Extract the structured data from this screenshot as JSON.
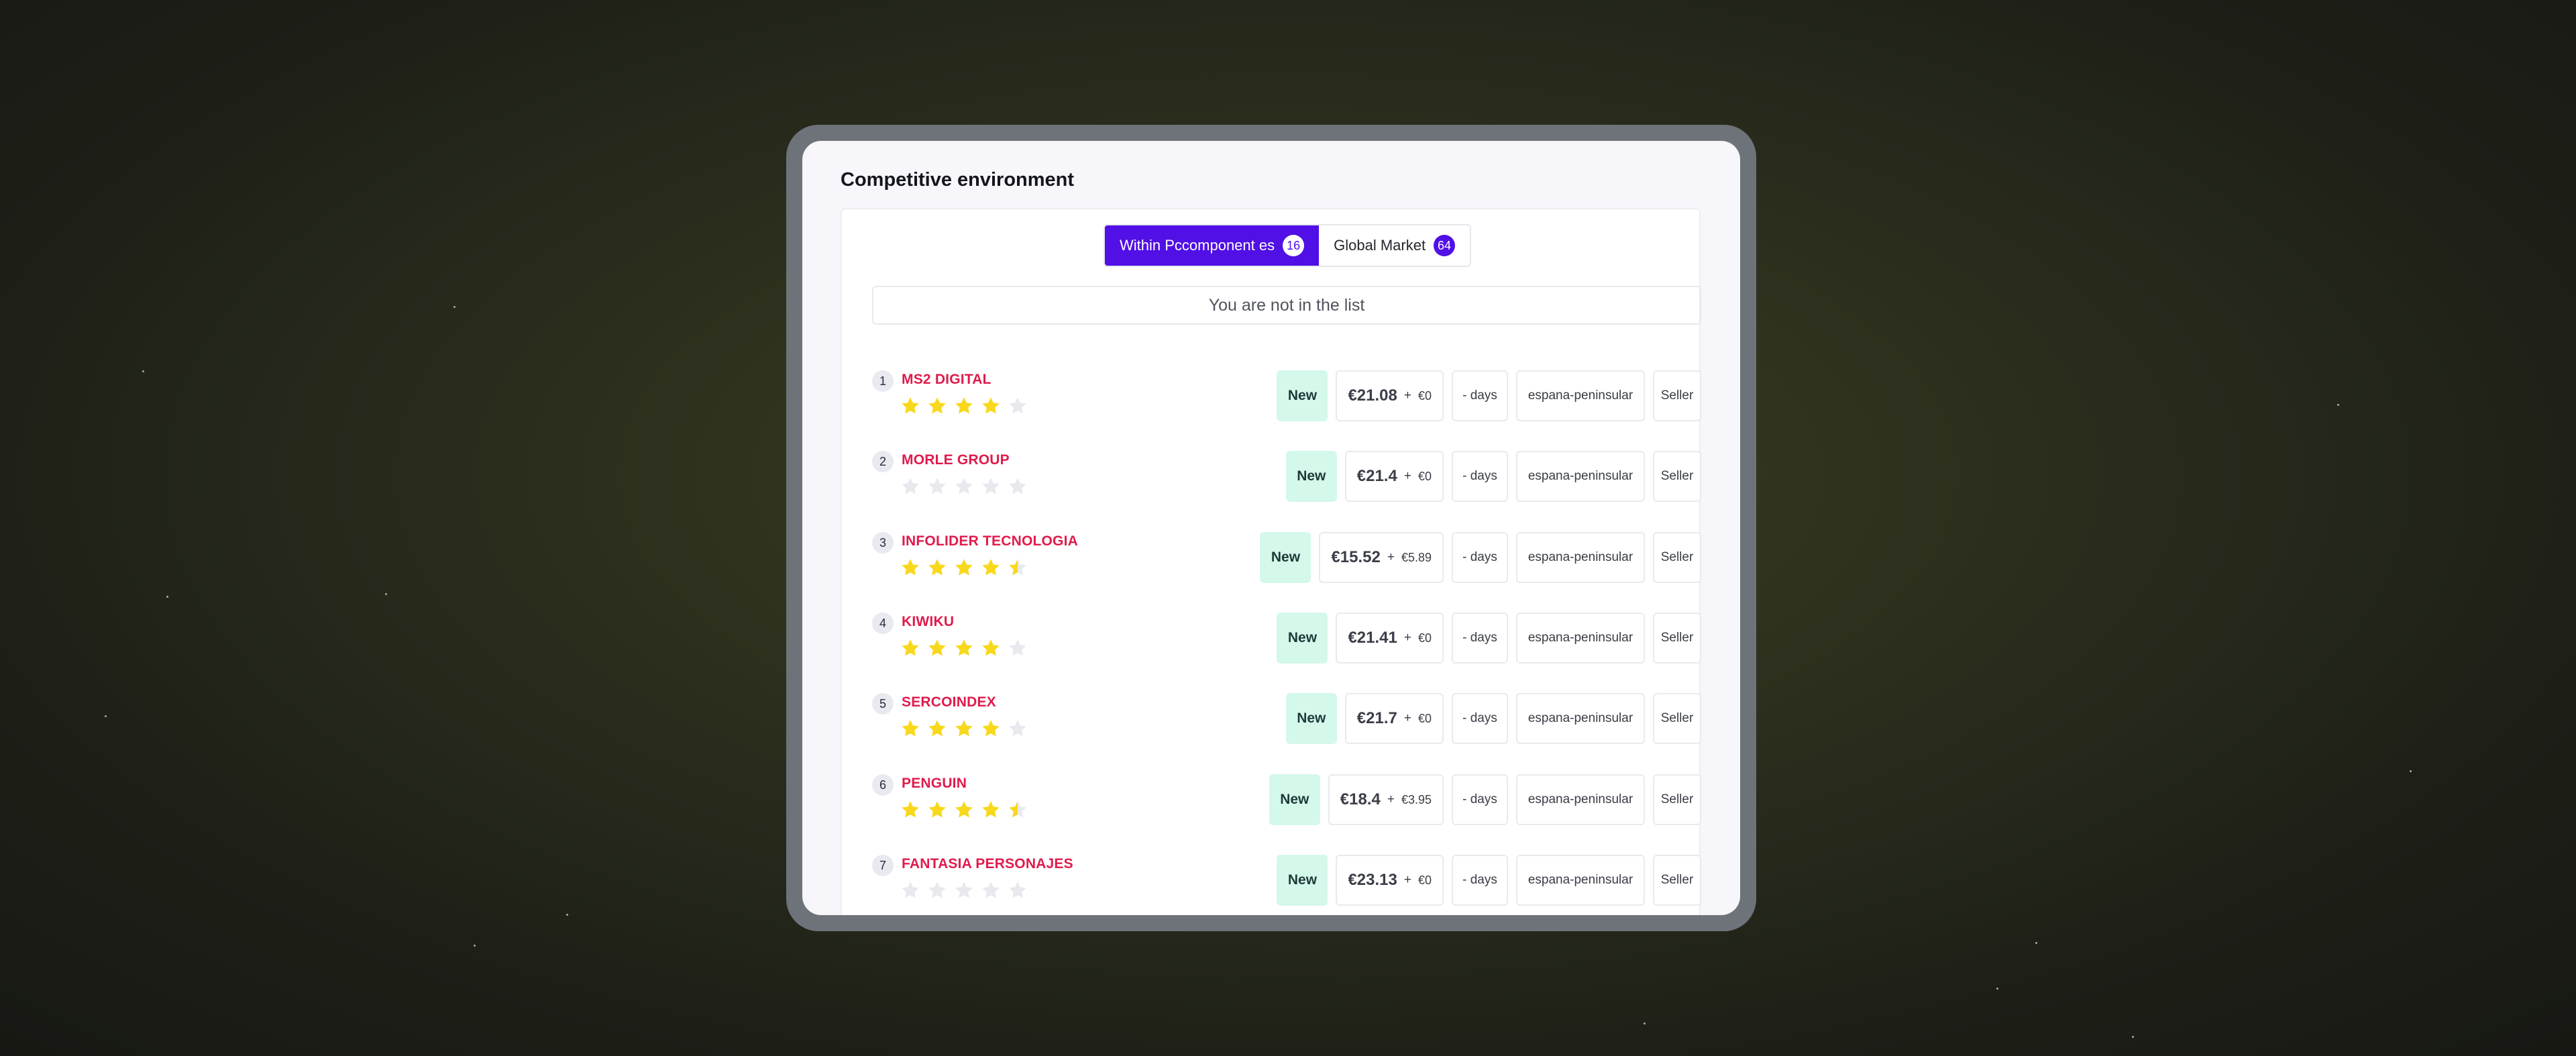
{
  "panel": {
    "title": "Competitive environment"
  },
  "tabs": [
    {
      "label": "Within Pccomponent es",
      "count": "16",
      "active": true
    },
    {
      "label": "Global Market",
      "count": "64",
      "active": false
    }
  ],
  "notice": "You are not in the list",
  "colors": {
    "accent": "#5010e6",
    "seller_name": "#e01b4c",
    "new_badge_bg": "#d4f8ea",
    "star_filled": "#f8d81c",
    "star_empty": "#e8e9ee"
  },
  "sellers": [
    {
      "rank": "1",
      "name": "MS2 DIGITAL",
      "rating": 4,
      "condition": "New",
      "price": "€21.08",
      "plus": "+",
      "shipping": "€0",
      "delivery": "- days",
      "region": "espana-peninsular",
      "role": "Seller"
    },
    {
      "rank": "2",
      "name": "MORLE GROUP",
      "rating": 0,
      "condition": "New",
      "price": "€21.4",
      "plus": "+",
      "shipping": "€0",
      "delivery": "- days",
      "region": "espana-peninsular",
      "role": "Seller"
    },
    {
      "rank": "3",
      "name": "INFOLIDER TECNOLOGIA",
      "rating": 4.5,
      "condition": "New",
      "price": "€15.52",
      "plus": "+",
      "shipping": "€5.89",
      "delivery": "- days",
      "region": "espana-peninsular",
      "role": "Seller"
    },
    {
      "rank": "4",
      "name": "KIWIKU",
      "rating": 4,
      "condition": "New",
      "price": "€21.41",
      "plus": "+",
      "shipping": "€0",
      "delivery": "- days",
      "region": "espana-peninsular",
      "role": "Seller"
    },
    {
      "rank": "5",
      "name": "SERCOINDEX",
      "rating": 4,
      "condition": "New",
      "price": "€21.7",
      "plus": "+",
      "shipping": "€0",
      "delivery": "- days",
      "region": "espana-peninsular",
      "role": "Seller"
    },
    {
      "rank": "6",
      "name": "PENGUIN",
      "rating": 4.5,
      "condition": "New",
      "price": "€18.4",
      "plus": "+",
      "shipping": "€3.95",
      "delivery": "- days",
      "region": "espana-peninsular",
      "role": "Seller"
    },
    {
      "rank": "7",
      "name": "FANTASIA PERSONAJES",
      "rating": 0,
      "condition": "New",
      "price": "€23.13",
      "plus": "+",
      "shipping": "€0",
      "delivery": "- days",
      "region": "espana-peninsular",
      "role": "Seller"
    }
  ]
}
